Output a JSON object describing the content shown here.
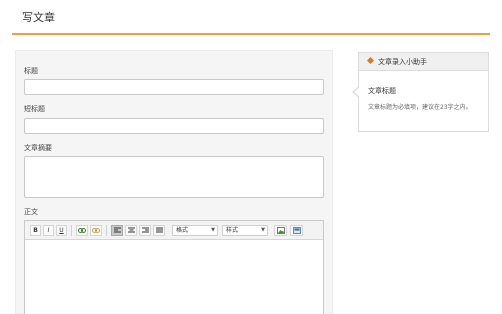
{
  "header": {
    "title": "写文章",
    "accent_color": "#e8a33b"
  },
  "form": {
    "title_label": "标题",
    "short_title_label": "短标题",
    "summary_label": "文章摘要",
    "body_label": "正文"
  },
  "toolbar": {
    "bold": "B",
    "italic": "I",
    "underline": "U",
    "format_select": "格式",
    "style_select": "样式"
  },
  "helper": {
    "header": "文章录入小助手",
    "title": "文章标题",
    "text": "文章标题为必填项，建议在23字之内。",
    "accent_color": "#e8731e"
  }
}
